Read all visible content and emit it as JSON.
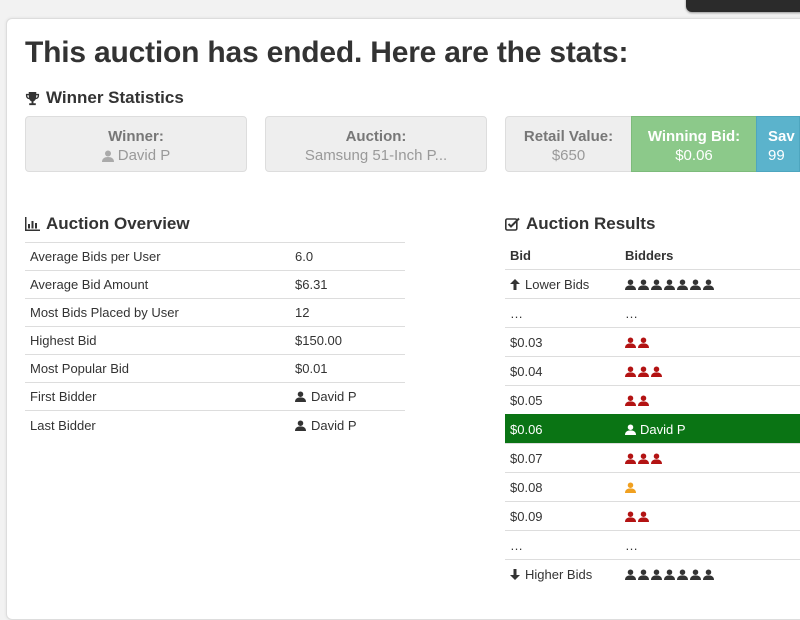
{
  "headline": "This auction has ended. Here are the stats:",
  "winner_stats": {
    "title": "Winner Statistics",
    "boxes": [
      {
        "label": "Winner:",
        "value": "David P"
      },
      {
        "label": "Auction:",
        "value": "Samsung 51-Inch P..."
      },
      {
        "label": "Retail Value:",
        "value": "$650"
      },
      {
        "label": "Winning Bid:",
        "value": "$0.06"
      },
      {
        "label": "Sav",
        "value": "99"
      }
    ]
  },
  "overview": {
    "title": "Auction Overview",
    "rows": [
      {
        "label": "Average Bids per User",
        "value": "6.0"
      },
      {
        "label": "Average Bid Amount",
        "value": "$6.31"
      },
      {
        "label": "Most Bids Placed by User",
        "value": "12"
      },
      {
        "label": "Highest Bid",
        "value": "$150.00"
      },
      {
        "label": "Most Popular Bid",
        "value": "$0.01"
      },
      {
        "label": "First Bidder",
        "value": "David P"
      },
      {
        "label": "Last Bidder",
        "value": "David P"
      }
    ]
  },
  "results": {
    "title": "Auction Results",
    "col_bid": "Bid",
    "col_bidders": "Bidders",
    "lower_label": "Lower Bids",
    "higher_label": "Higher Bids",
    "ellipsis": "…",
    "rows": [
      {
        "bid": "$0.03",
        "bidder_count": 2,
        "color": "#b31313"
      },
      {
        "bid": "$0.04",
        "bidder_count": 3,
        "color": "#b31313"
      },
      {
        "bid": "$0.05",
        "bidder_count": 2,
        "color": "#b31313"
      },
      {
        "bid": "$0.06",
        "winner": "David P"
      },
      {
        "bid": "$0.07",
        "bidder_count": 3,
        "color": "#b31313"
      },
      {
        "bid": "$0.08",
        "bidder_count": 1,
        "color": "#f0a020"
      },
      {
        "bid": "$0.09",
        "bidder_count": 2,
        "color": "#b31313"
      }
    ],
    "winner_row_color": "#0a7414"
  }
}
